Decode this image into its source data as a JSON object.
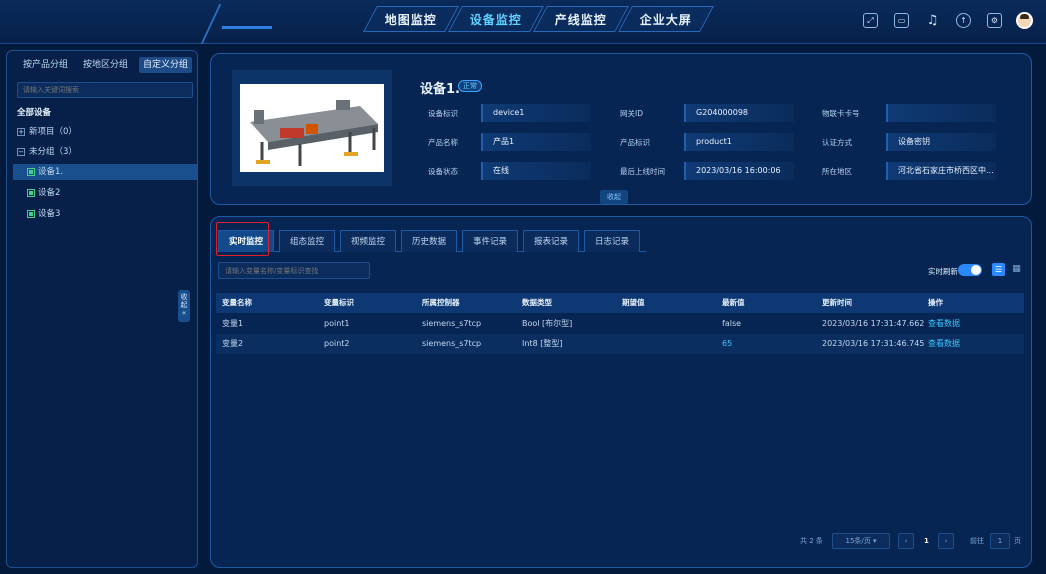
{
  "nav": {
    "tabs": [
      {
        "label": "地图监控"
      },
      {
        "label": "设备监控"
      },
      {
        "label": "产线监控"
      },
      {
        "label": "企业大屏"
      }
    ],
    "icons": [
      "fullscreen-icon",
      "screen-icon",
      "bell-icon",
      "upload-icon",
      "gear-icon"
    ]
  },
  "left": {
    "tabs": [
      "按产品分组",
      "按地区分组",
      "自定义分组"
    ],
    "search_placeholder": "请输入关键词搜索",
    "tree": {
      "root": "全部设备",
      "groups": [
        {
          "label": "新项目（0）",
          "toggle": "+"
        },
        {
          "label": "未分组（3）",
          "toggle": "−"
        }
      ],
      "devices": [
        "设备1.",
        "设备2",
        "设备3"
      ]
    },
    "collapse_label": "收起",
    "collapse_arrow": "«"
  },
  "device": {
    "name": "设备1.",
    "badge": "正常",
    "fields": [
      {
        "label": "设备标识",
        "value": "device1"
      },
      {
        "label": "网关ID",
        "value": "G204000098"
      },
      {
        "label": "物联卡卡号",
        "value": ""
      },
      {
        "label": "产品名称",
        "value": "产品1"
      },
      {
        "label": "产品标识",
        "value": "product1"
      },
      {
        "label": "认证方式",
        "value": "设备密钥"
      },
      {
        "label": "设备状态",
        "value": "在线"
      },
      {
        "label": "最后上线时间",
        "value": "2023/03/16 16:00:06"
      },
      {
        "label": "所在地区",
        "value": "河北省石家庄市桥西区中..."
      }
    ],
    "collapse_label": "收起"
  },
  "main": {
    "tabs": [
      "实时监控",
      "组态监控",
      "视频监控",
      "历史数据",
      "事件记录",
      "报表记录",
      "日志记录"
    ],
    "search_placeholder": "请输入变量名称/变量标识查找",
    "realtime_label": "实时刷新",
    "realtime_on": true,
    "table": {
      "headers": [
        "变量名称",
        "变量标识",
        "所属控制器",
        "数据类型",
        "期望值",
        "最新值",
        "更新时间",
        "操作"
      ],
      "rows": [
        [
          "变量1",
          "point1",
          "siemens_s7tcp",
          "Bool [布尔型]",
          "",
          "false",
          "2023/03/16 17:31:47.662",
          "查看数据"
        ],
        [
          "变量2",
          "point2",
          "siemens_s7tcp",
          "Int8 [整型]",
          "",
          "65",
          "2023/03/16 17:31:46.745",
          "查看数据"
        ]
      ]
    },
    "pager": {
      "total": "共 2 条",
      "page_size": "15条/页",
      "prev": "‹",
      "current": "1",
      "next": "›",
      "goto_label": "前往",
      "goto_value": "1",
      "page_unit": "页"
    }
  }
}
